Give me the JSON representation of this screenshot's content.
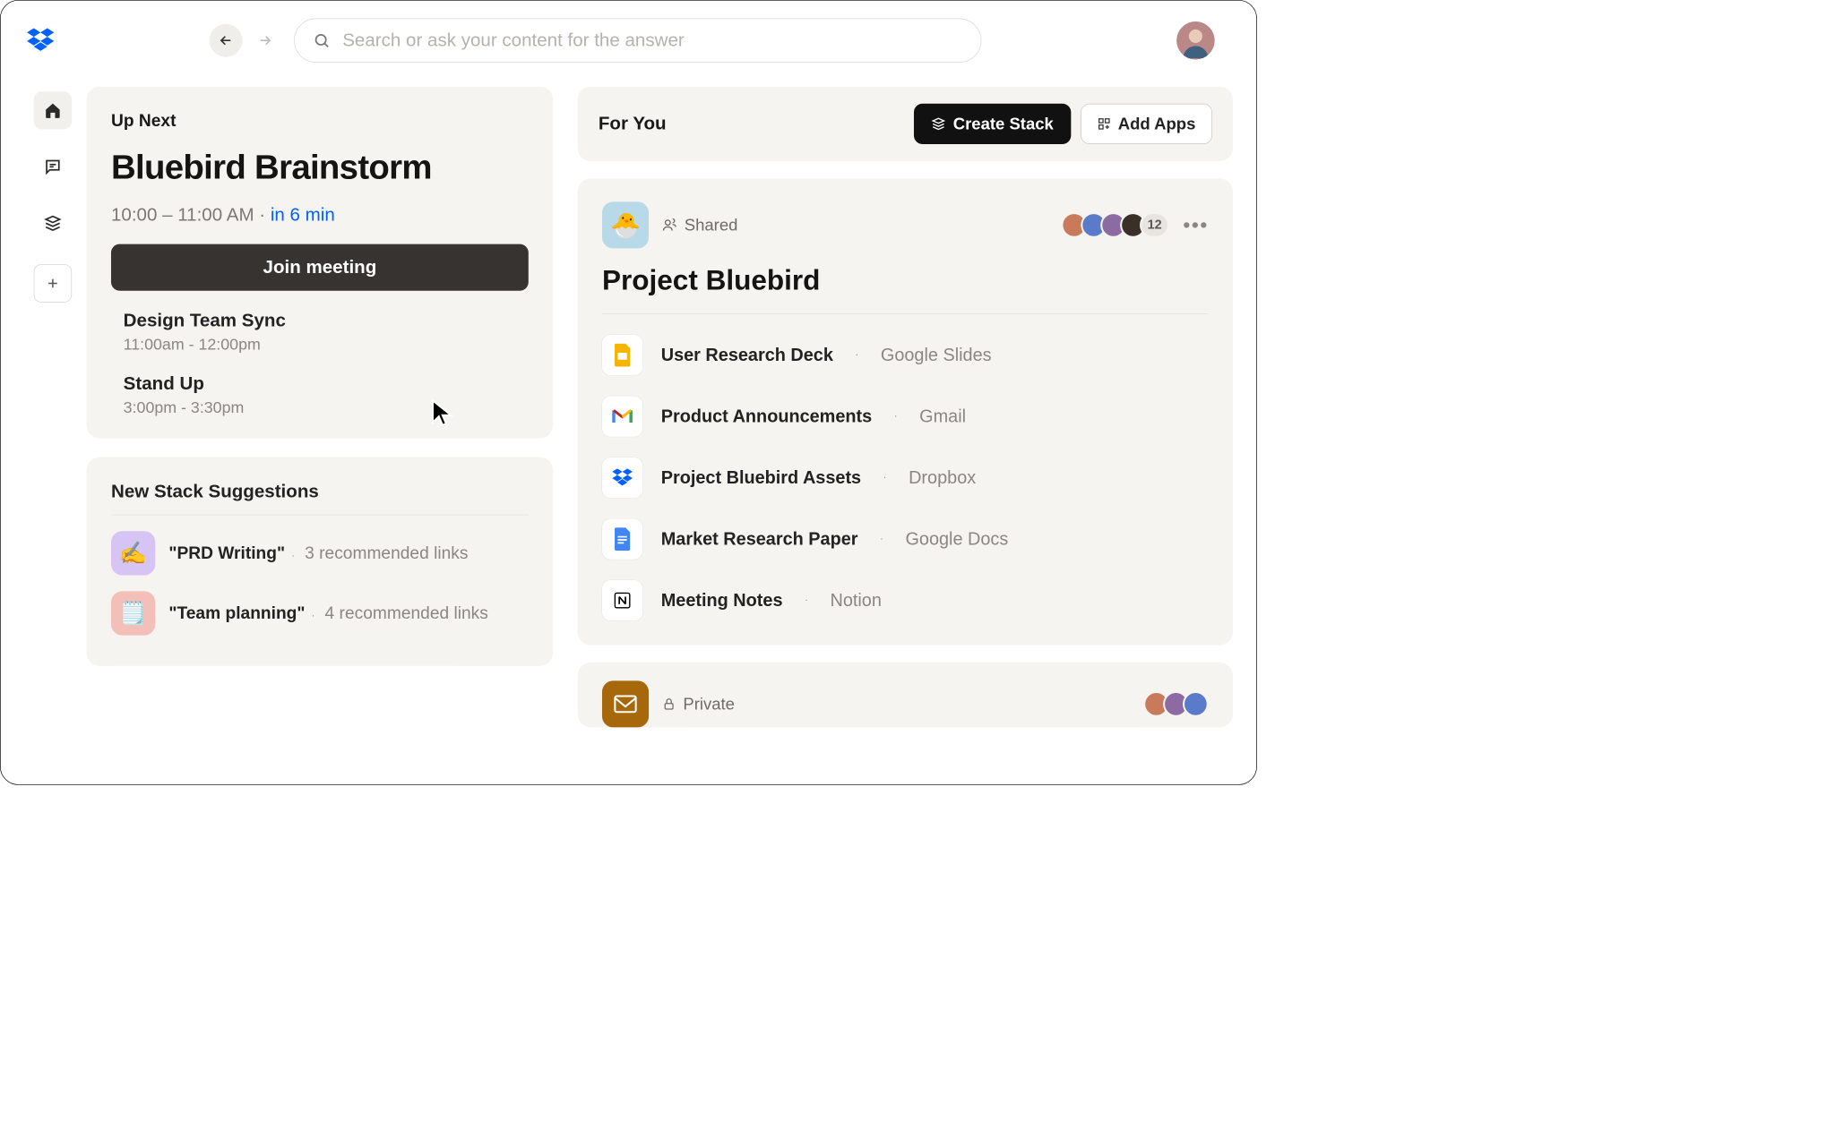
{
  "search": {
    "placeholder": "Search or ask your content for the answer"
  },
  "upnext": {
    "label": "Up Next",
    "title": "Bluebird Brainstorm",
    "time_range": "10:00 – 11:00 AM",
    "countdown": "in 6 min",
    "join_label": "Join meeting",
    "events": [
      {
        "title": "Design Team Sync",
        "time": "11:00am - 12:00pm"
      },
      {
        "title": "Stand Up",
        "time": "3:00pm - 3:30pm"
      }
    ]
  },
  "suggestions": {
    "heading": "New Stack Suggestions",
    "items": [
      {
        "emoji": "✍️",
        "name": "\"PRD Writing\"",
        "meta": "3 recommended links"
      },
      {
        "emoji": "🗒️",
        "name": "\"Team planning\"",
        "meta": "4 recommended links"
      }
    ]
  },
  "for_you": {
    "label": "For You",
    "create_stack": "Create Stack",
    "add_apps": "Add Apps"
  },
  "stack": {
    "emoji": "🐣",
    "shared_label": "Shared",
    "title": "Project Bluebird",
    "extra_count": "12",
    "docs": [
      {
        "name": "User Research Deck",
        "source": "Google Slides",
        "icon": "slides"
      },
      {
        "name": "Product Announcements",
        "source": "Gmail",
        "icon": "gmail"
      },
      {
        "name": "Project Bluebird Assets",
        "source": "Dropbox",
        "icon": "dropbox"
      },
      {
        "name": "Market Research Paper",
        "source": "Google Docs",
        "icon": "docs"
      },
      {
        "name": "Meeting Notes",
        "source": "Notion",
        "icon": "notion"
      }
    ]
  },
  "private": {
    "label": "Private"
  }
}
